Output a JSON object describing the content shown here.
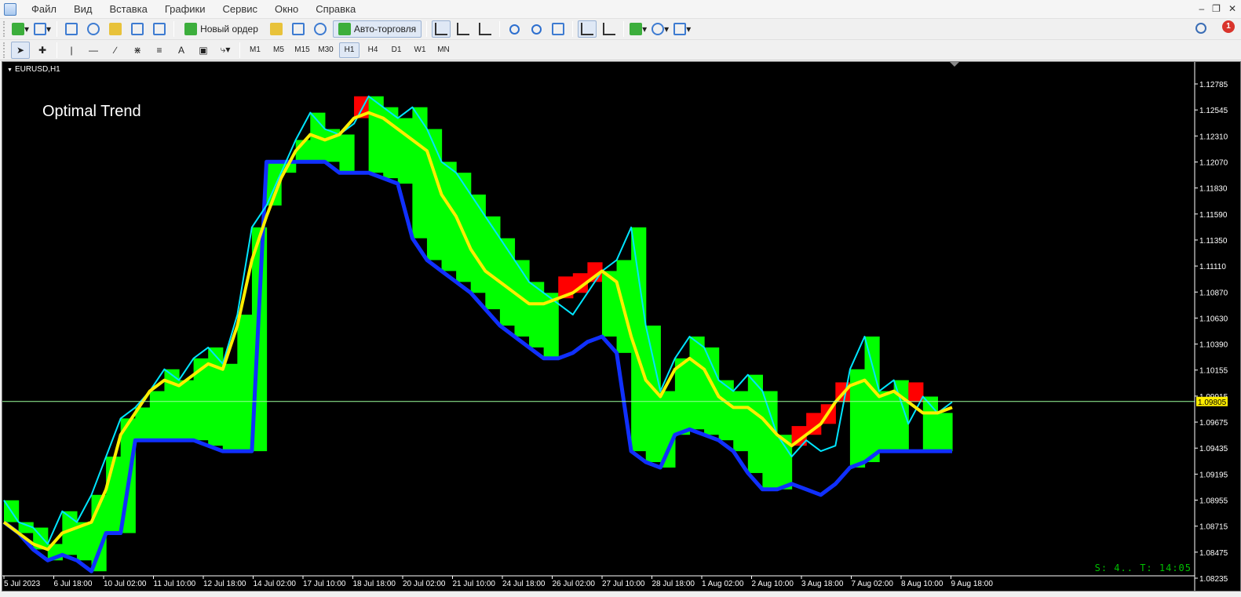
{
  "menu": {
    "items": [
      "Файл",
      "Вид",
      "Вставка",
      "Графики",
      "Сервис",
      "Окно",
      "Справка"
    ]
  },
  "toolbar": {
    "new_order_label": "Новый ордер",
    "autotrading_label": "Авто-торговля",
    "timeframes": [
      "M1",
      "M5",
      "M15",
      "M30",
      "H1",
      "H4",
      "D1",
      "W1",
      "MN"
    ],
    "active_timeframe": "H1",
    "notification_count": "1",
    "text_tool": "A"
  },
  "chart": {
    "symbol_label": "EURUSD,H1",
    "indicator_label": "Optimal Trend",
    "status_text": "S: 4.. T: 14:05",
    "current_price_label": "1.09805",
    "colors": {
      "background": "#000000",
      "bearish_fill": "#ff0000",
      "bullish_fill": "#00ff00",
      "price_line": "#00e5ff",
      "trend_line": "#ffee00",
      "support_line": "#1030ff",
      "current_price_line": "#9cff9c",
      "axis_text": "#ffffff"
    }
  },
  "chart_data": {
    "type": "line",
    "title": "",
    "symbol": "EURUSD",
    "timeframe": "H1",
    "ylim": [
      1.0823,
      1.129
    ],
    "price_ticks": [
      "1.12785",
      "1.12545",
      "1.12310",
      "1.12070",
      "1.11830",
      "1.11590",
      "1.11350",
      "1.11110",
      "1.10870",
      "1.10630",
      "1.10390",
      "1.10155",
      "1.09915",
      "1.09675",
      "1.09435",
      "1.09195",
      "1.08955",
      "1.08715",
      "1.08475",
      "1.08235"
    ],
    "time_ticks": [
      "5 Jul 2023",
      "6 Jul 18:00",
      "10 Jul 02:00",
      "11 Jul 10:00",
      "12 Jul 18:00",
      "14 Jul 02:00",
      "17 Jul 10:00",
      "18 Jul 18:00",
      "20 Jul 02:00",
      "21 Jul 10:00",
      "24 Jul 18:00",
      "26 Jul 02:00",
      "27 Jul 10:00",
      "28 Jul 18:00",
      "1 Aug 02:00",
      "2 Aug 10:00",
      "3 Aug 18:00",
      "7 Aug 02:00",
      "8 Aug 10:00",
      "9 Aug 18:00"
    ],
    "current_price": 1.09805,
    "series": [
      {
        "role": "price",
        "values": [
          1.089,
          1.087,
          1.0865,
          1.085,
          1.088,
          1.087,
          1.0895,
          1.093,
          1.0965,
          1.0975,
          1.099,
          1.101,
          1.1,
          1.102,
          1.103,
          1.1015,
          1.106,
          1.114,
          1.116,
          1.119,
          1.122,
          1.1245,
          1.123,
          1.1225,
          1.1235,
          1.126,
          1.125,
          1.124,
          1.125,
          1.123,
          1.12,
          1.119,
          1.117,
          1.115,
          1.113,
          1.111,
          1.109,
          1.108,
          1.107,
          1.106,
          1.108,
          1.11,
          1.111,
          1.114,
          1.105,
          1.099,
          1.102,
          1.104,
          1.103,
          1.1,
          1.099,
          1.1005,
          1.099,
          1.095,
          1.093,
          1.0945,
          1.0935,
          1.094,
          1.101,
          1.104,
          1.099,
          1.1,
          1.096,
          1.0985,
          1.097,
          1.098
        ]
      },
      {
        "role": "trend",
        "values": [
          1.087,
          1.086,
          1.085,
          1.0845,
          1.086,
          1.0865,
          1.087,
          1.09,
          1.095,
          1.097,
          1.099,
          1.1,
          1.0995,
          1.1005,
          1.1015,
          1.101,
          1.105,
          1.111,
          1.115,
          1.1185,
          1.121,
          1.1225,
          1.122,
          1.1225,
          1.124,
          1.1245,
          1.124,
          1.123,
          1.122,
          1.121,
          1.117,
          1.115,
          1.112,
          1.11,
          1.109,
          1.108,
          1.107,
          1.107,
          1.1075,
          1.108,
          1.109,
          1.11,
          1.109,
          1.104,
          1.1,
          1.0985,
          1.101,
          1.102,
          1.101,
          1.0985,
          1.0975,
          1.0975,
          1.0965,
          1.095,
          1.094,
          1.095,
          1.096,
          1.098,
          1.0995,
          1.1,
          1.0985,
          1.099,
          1.098,
          1.097,
          1.097,
          1.0975
        ]
      },
      {
        "role": "support",
        "values": [
          1.087,
          1.086,
          1.0845,
          1.0835,
          1.084,
          1.0835,
          1.0825,
          1.086,
          1.086,
          1.0945,
          1.0945,
          1.0945,
          1.0945,
          1.0945,
          1.094,
          1.0935,
          1.0935,
          1.0935,
          1.12,
          1.12,
          1.12,
          1.12,
          1.12,
          1.119,
          1.119,
          1.119,
          1.1185,
          1.118,
          1.113,
          1.111,
          1.11,
          1.109,
          1.108,
          1.1065,
          1.105,
          1.104,
          1.103,
          1.102,
          1.102,
          1.1025,
          1.1035,
          1.104,
          1.1025,
          1.0935,
          1.0925,
          1.092,
          1.095,
          1.0955,
          1.095,
          1.0945,
          1.0935,
          1.0915,
          1.09,
          1.09,
          1.0905,
          1.09,
          1.0895,
          1.0905,
          1.092,
          1.0925,
          1.0935,
          1.0935,
          1.0935,
          1.0935,
          1.0935,
          1.0935
        ]
      }
    ],
    "xlabel": "",
    "ylabel": ""
  }
}
